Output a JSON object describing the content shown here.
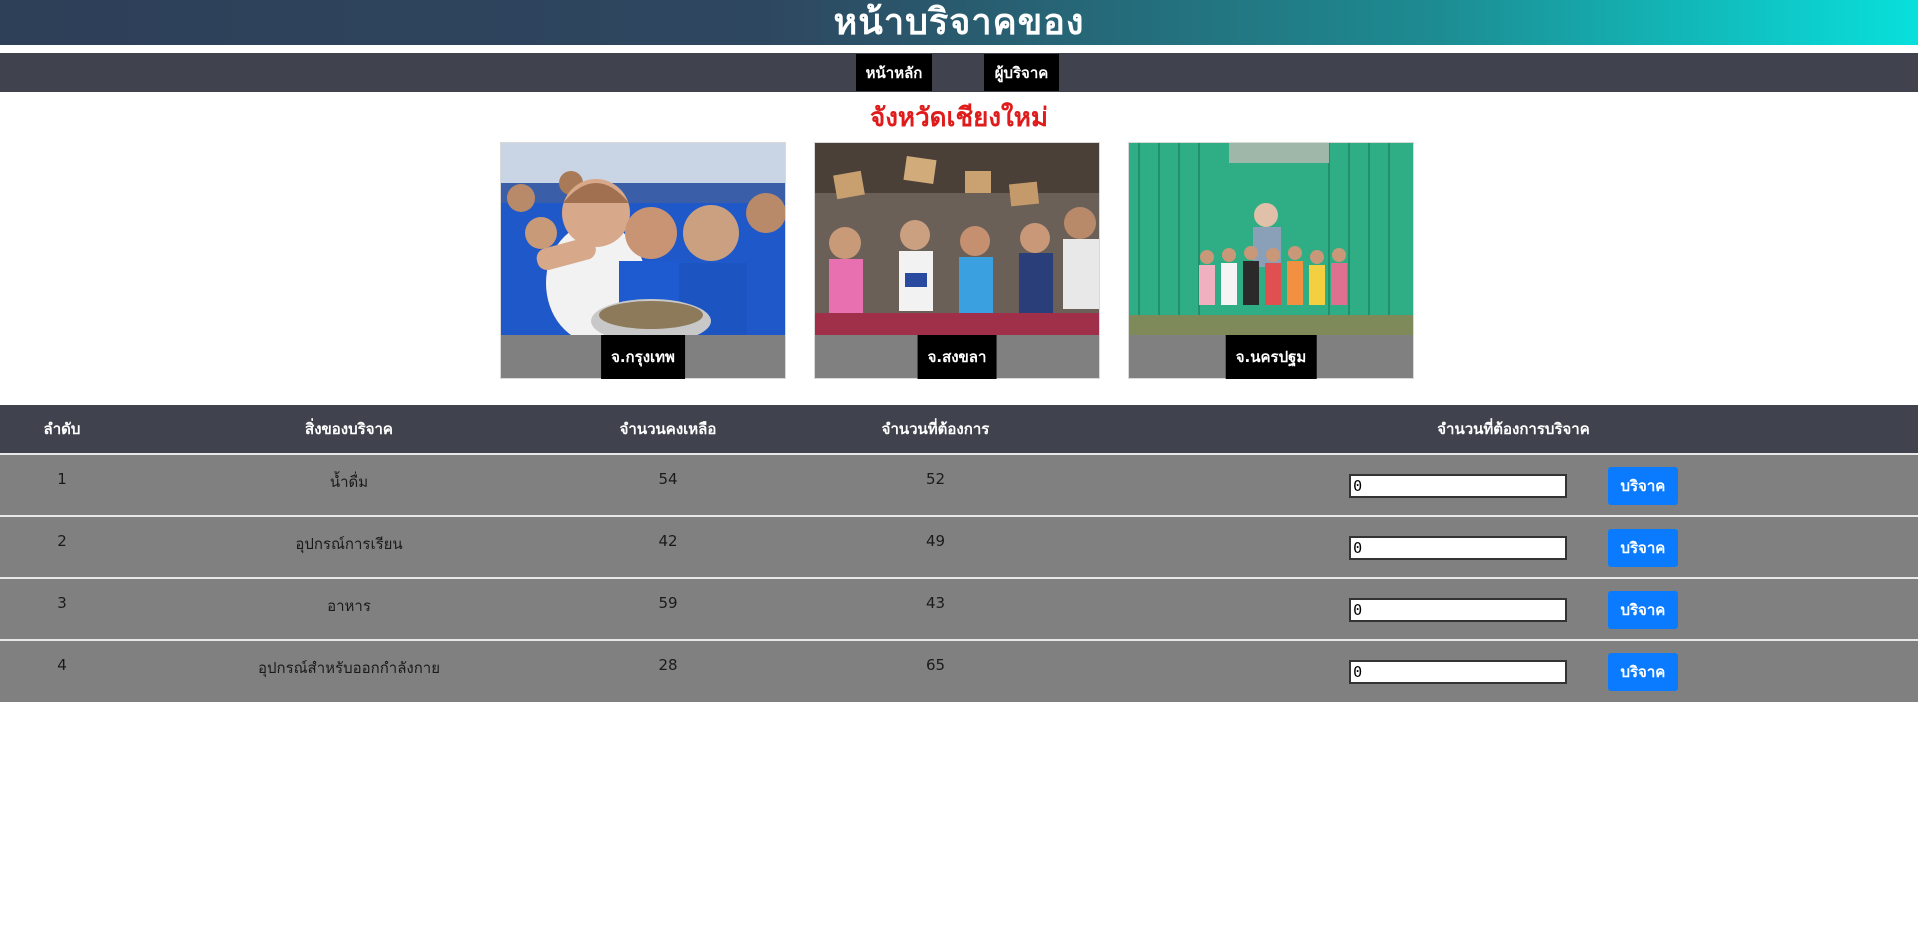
{
  "header": {
    "title": "หน้าบริจาคของ"
  },
  "nav": {
    "home": "หน้าหลัก",
    "donor": "ผู้บริจาค"
  },
  "province": "จังหวัดเชียงใหม่",
  "cards": [
    {
      "caption": "จ.กรุงเทพ"
    },
    {
      "caption": "จ.สงขลา"
    },
    {
      "caption": "จ.นครปฐม"
    }
  ],
  "table": {
    "headers": [
      "ลำดับ",
      "สิ่งของบริจาค",
      "จำนวนคงเหลือ",
      "จำนวนที่ต้องการ",
      "จำนวนที่ต้องการบริจาค"
    ],
    "rows": [
      {
        "no": "1",
        "item": "น้ำดื่ม",
        "remaining": "54",
        "needed": "52",
        "input_value": "0",
        "button": "บริจาค"
      },
      {
        "no": "2",
        "item": "อุปกรณ์การเรียน",
        "remaining": "42",
        "needed": "49",
        "input_value": "0",
        "button": "บริจาค"
      },
      {
        "no": "3",
        "item": "อาหาร",
        "remaining": "59",
        "needed": "43",
        "input_value": "0",
        "button": "บริจาค"
      },
      {
        "no": "4",
        "item": "อุปกรณ์สำหรับออกกำลังกาย",
        "remaining": "28",
        "needed": "65",
        "input_value": "0",
        "button": "บริจาค"
      }
    ]
  },
  "colors": {
    "accent": "#0a7bff",
    "province": "#e01b1b",
    "nav_bg": "#40434e",
    "row_bg": "#808080"
  }
}
